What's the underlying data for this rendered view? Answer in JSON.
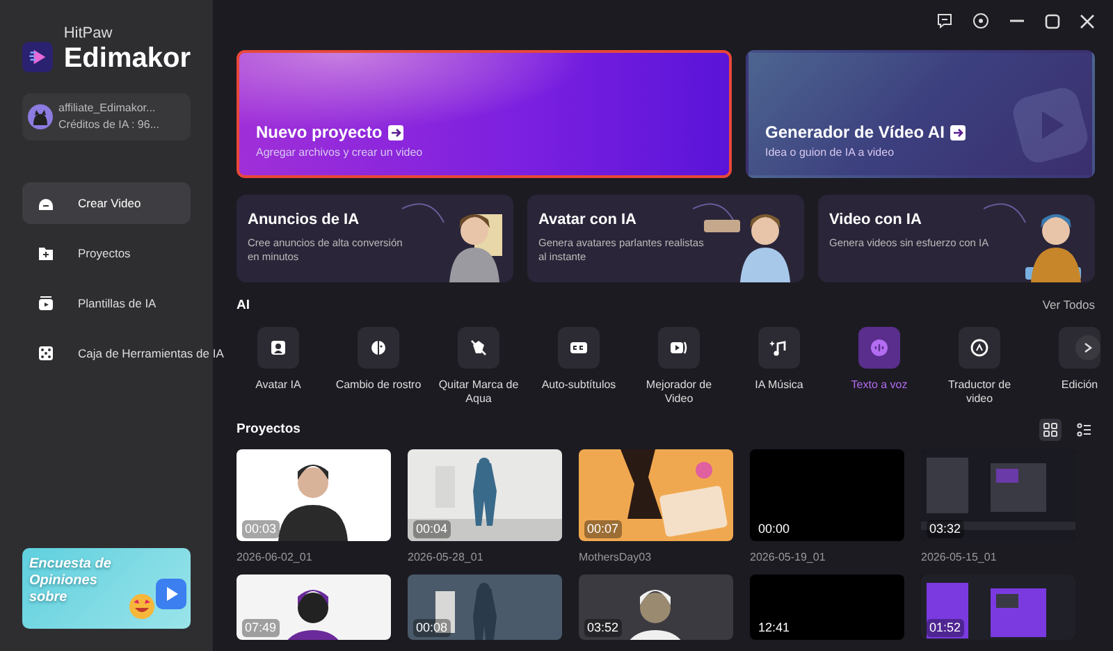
{
  "sidebar": {
    "brand": "HitPaw",
    "app_name": "Edimakor",
    "account": {
      "username": "affiliate_Edimakor...",
      "credits": "Créditos de IA : 96..."
    },
    "nav": [
      {
        "label": "Crear Video",
        "selected": true
      },
      {
        "label": "Proyectos",
        "selected": false
      },
      {
        "label": "Plantillas de IA",
        "selected": false
      },
      {
        "label": "Caja de Herramientas de IA",
        "selected": false
      }
    ],
    "banner": {
      "text": "Encuesta de Opiniones sobre"
    }
  },
  "hero_cards": [
    {
      "title": "Nuevo proyecto",
      "subtitle": "Agregar archivos y crear un video",
      "selected": true
    },
    {
      "title": "Generador de Vídeo AI",
      "subtitle": "Idea o guion de IA a video",
      "selected": false
    }
  ],
  "feature_cards": [
    {
      "title": "Anuncios de IA",
      "text": "Cree anuncios de alta conversión en minutos"
    },
    {
      "title": "Avatar con IA",
      "text": "Genera avatares parlantes realistas al instante"
    },
    {
      "title": "Video con IA",
      "text": "Genera videos sin esfuerzo con IA"
    }
  ],
  "ai_tools": {
    "title": "AI",
    "link": "Ver Todos",
    "items": [
      {
        "label": "Avatar IA",
        "selected": false
      },
      {
        "label": "Cambio de rostro",
        "selected": false
      },
      {
        "label": "Quitar Marca de Aqua",
        "selected": false
      },
      {
        "label": "Auto-subtítulos",
        "selected": false
      },
      {
        "label": "Mejorador de Video",
        "selected": false
      },
      {
        "label": "IA Música",
        "selected": false
      },
      {
        "label": "Texto a voz",
        "selected": true
      },
      {
        "label": "Traductor de video",
        "selected": false
      },
      {
        "label": "Edición",
        "selected": false
      }
    ]
  },
  "projects": {
    "title": "Proyectos",
    "view_toggles": [
      {
        "selected": true
      },
      {
        "selected": false
      }
    ],
    "items": [
      {
        "name": "2026-06-02_01",
        "duration": "00:03",
        "kind": "picture"
      },
      {
        "name": "2026-05-28_01",
        "duration": "00:04",
        "kind": "picture"
      },
      {
        "name": "MothersDay03",
        "duration": "00:07",
        "kind": "picture"
      },
      {
        "name": "2026-05-19_01",
        "duration": "00:00",
        "kind": "blank"
      },
      {
        "name": "2026-05-15_01",
        "duration": "03:32",
        "kind": "picture"
      },
      {
        "duration": "07:49",
        "kind": "picture"
      },
      {
        "duration": "00:08",
        "kind": "picture"
      },
      {
        "duration": "03:52",
        "kind": "picture"
      },
      {
        "duration": "12:41",
        "kind": "blank"
      },
      {
        "duration": "01:52",
        "kind": "picture"
      }
    ]
  }
}
